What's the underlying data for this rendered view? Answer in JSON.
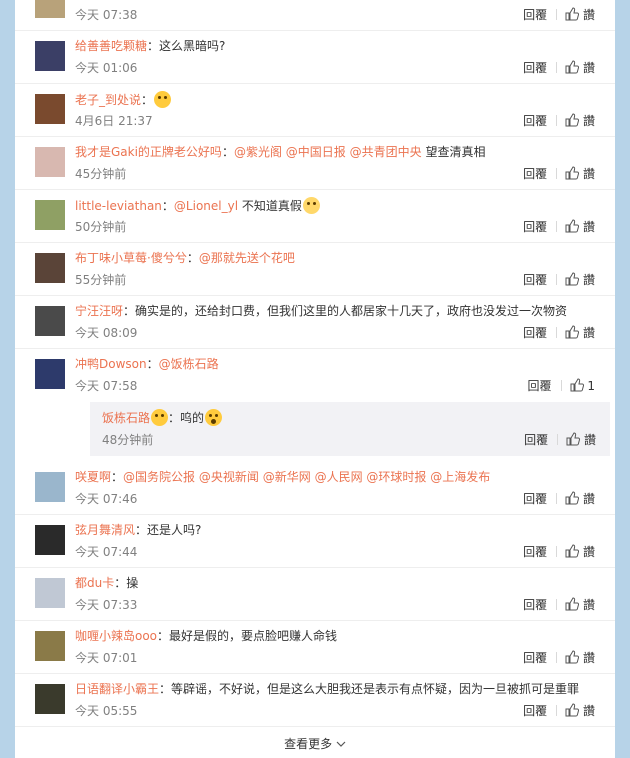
{
  "actions": {
    "reply_label": "回覆",
    "like_label": "讚"
  },
  "comments": [
    {
      "user": "",
      "parts": [],
      "time": "今天 07:38",
      "likes": ""
    },
    {
      "user": "给善善吃颗糖",
      "parts": [
        "：这么黑暗吗?"
      ],
      "time": "今天 01:06",
      "likes": ""
    },
    {
      "user": "老子_到处说",
      "parts": [
        "："
      ],
      "time": "4月6日 21:37",
      "likes": ""
    },
    {
      "user": "我才是Gaki的正牌老公好吗",
      "parts": [
        "：",
        "@紫光阁",
        " ",
        "@中国日报",
        " ",
        "@共青团中央",
        " 望查清真相"
      ],
      "time": "45分钟前",
      "likes": ""
    },
    {
      "user": "little-leviathan",
      "parts": [
        "：",
        "@Lionel_yl",
        " 不知道真假"
      ],
      "time": "50分钟前",
      "likes": ""
    },
    {
      "user": "布丁味小草莓·傻兮兮",
      "parts": [
        "：",
        "@那就先送个花吧"
      ],
      "time": "55分钟前",
      "likes": ""
    },
    {
      "user": "宁汪汪呀",
      "parts": [
        "：确实是的，还给封口费，但我们这里的人都居家十几天了，政府也没发过一次物资"
      ],
      "time": "今天 08:09",
      "likes": ""
    },
    {
      "user": "冲鸭Dowson",
      "parts": [
        "：",
        "@饭栋石路"
      ],
      "time": "今天 07:58",
      "likes": "1"
    },
    {
      "user": "咲夏啊",
      "parts": [
        "：",
        "@国务院公报",
        " ",
        "@央视新闻",
        " ",
        "@新华网",
        " ",
        "@人民网",
        " ",
        "@环球时报",
        " ",
        "@上海发布"
      ],
      "time": "今天 07:46",
      "likes": ""
    },
    {
      "user": "弦月舞清风",
      "parts": [
        "：还是人吗?"
      ],
      "time": "今天 07:44",
      "likes": ""
    },
    {
      "user": "都du卡",
      "parts": [
        "：操"
      ],
      "time": "今天 07:33",
      "likes": ""
    },
    {
      "user": "咖喱小辣岛ooo",
      "parts": [
        "：最好是假的，要点脸吧赚人命钱"
      ],
      "time": "今天 07:01",
      "likes": ""
    },
    {
      "user": "日语翻译小霸王",
      "parts": [
        "：等辟谣，不好说，但是这么大胆我还是表示有点怀疑，因为一旦被抓可是重罪"
      ],
      "time": "今天 05:55",
      "likes": ""
    }
  ],
  "subreply": {
    "user": "饭栋石路",
    "parts": [
      "：呜的"
    ],
    "time": "48分钟前"
  },
  "footer": {
    "more_label": "查看更多"
  },
  "colors": {
    "link": "#eb7350",
    "background": "#b7d3e8",
    "subreply_bg": "#f2f2f5"
  }
}
